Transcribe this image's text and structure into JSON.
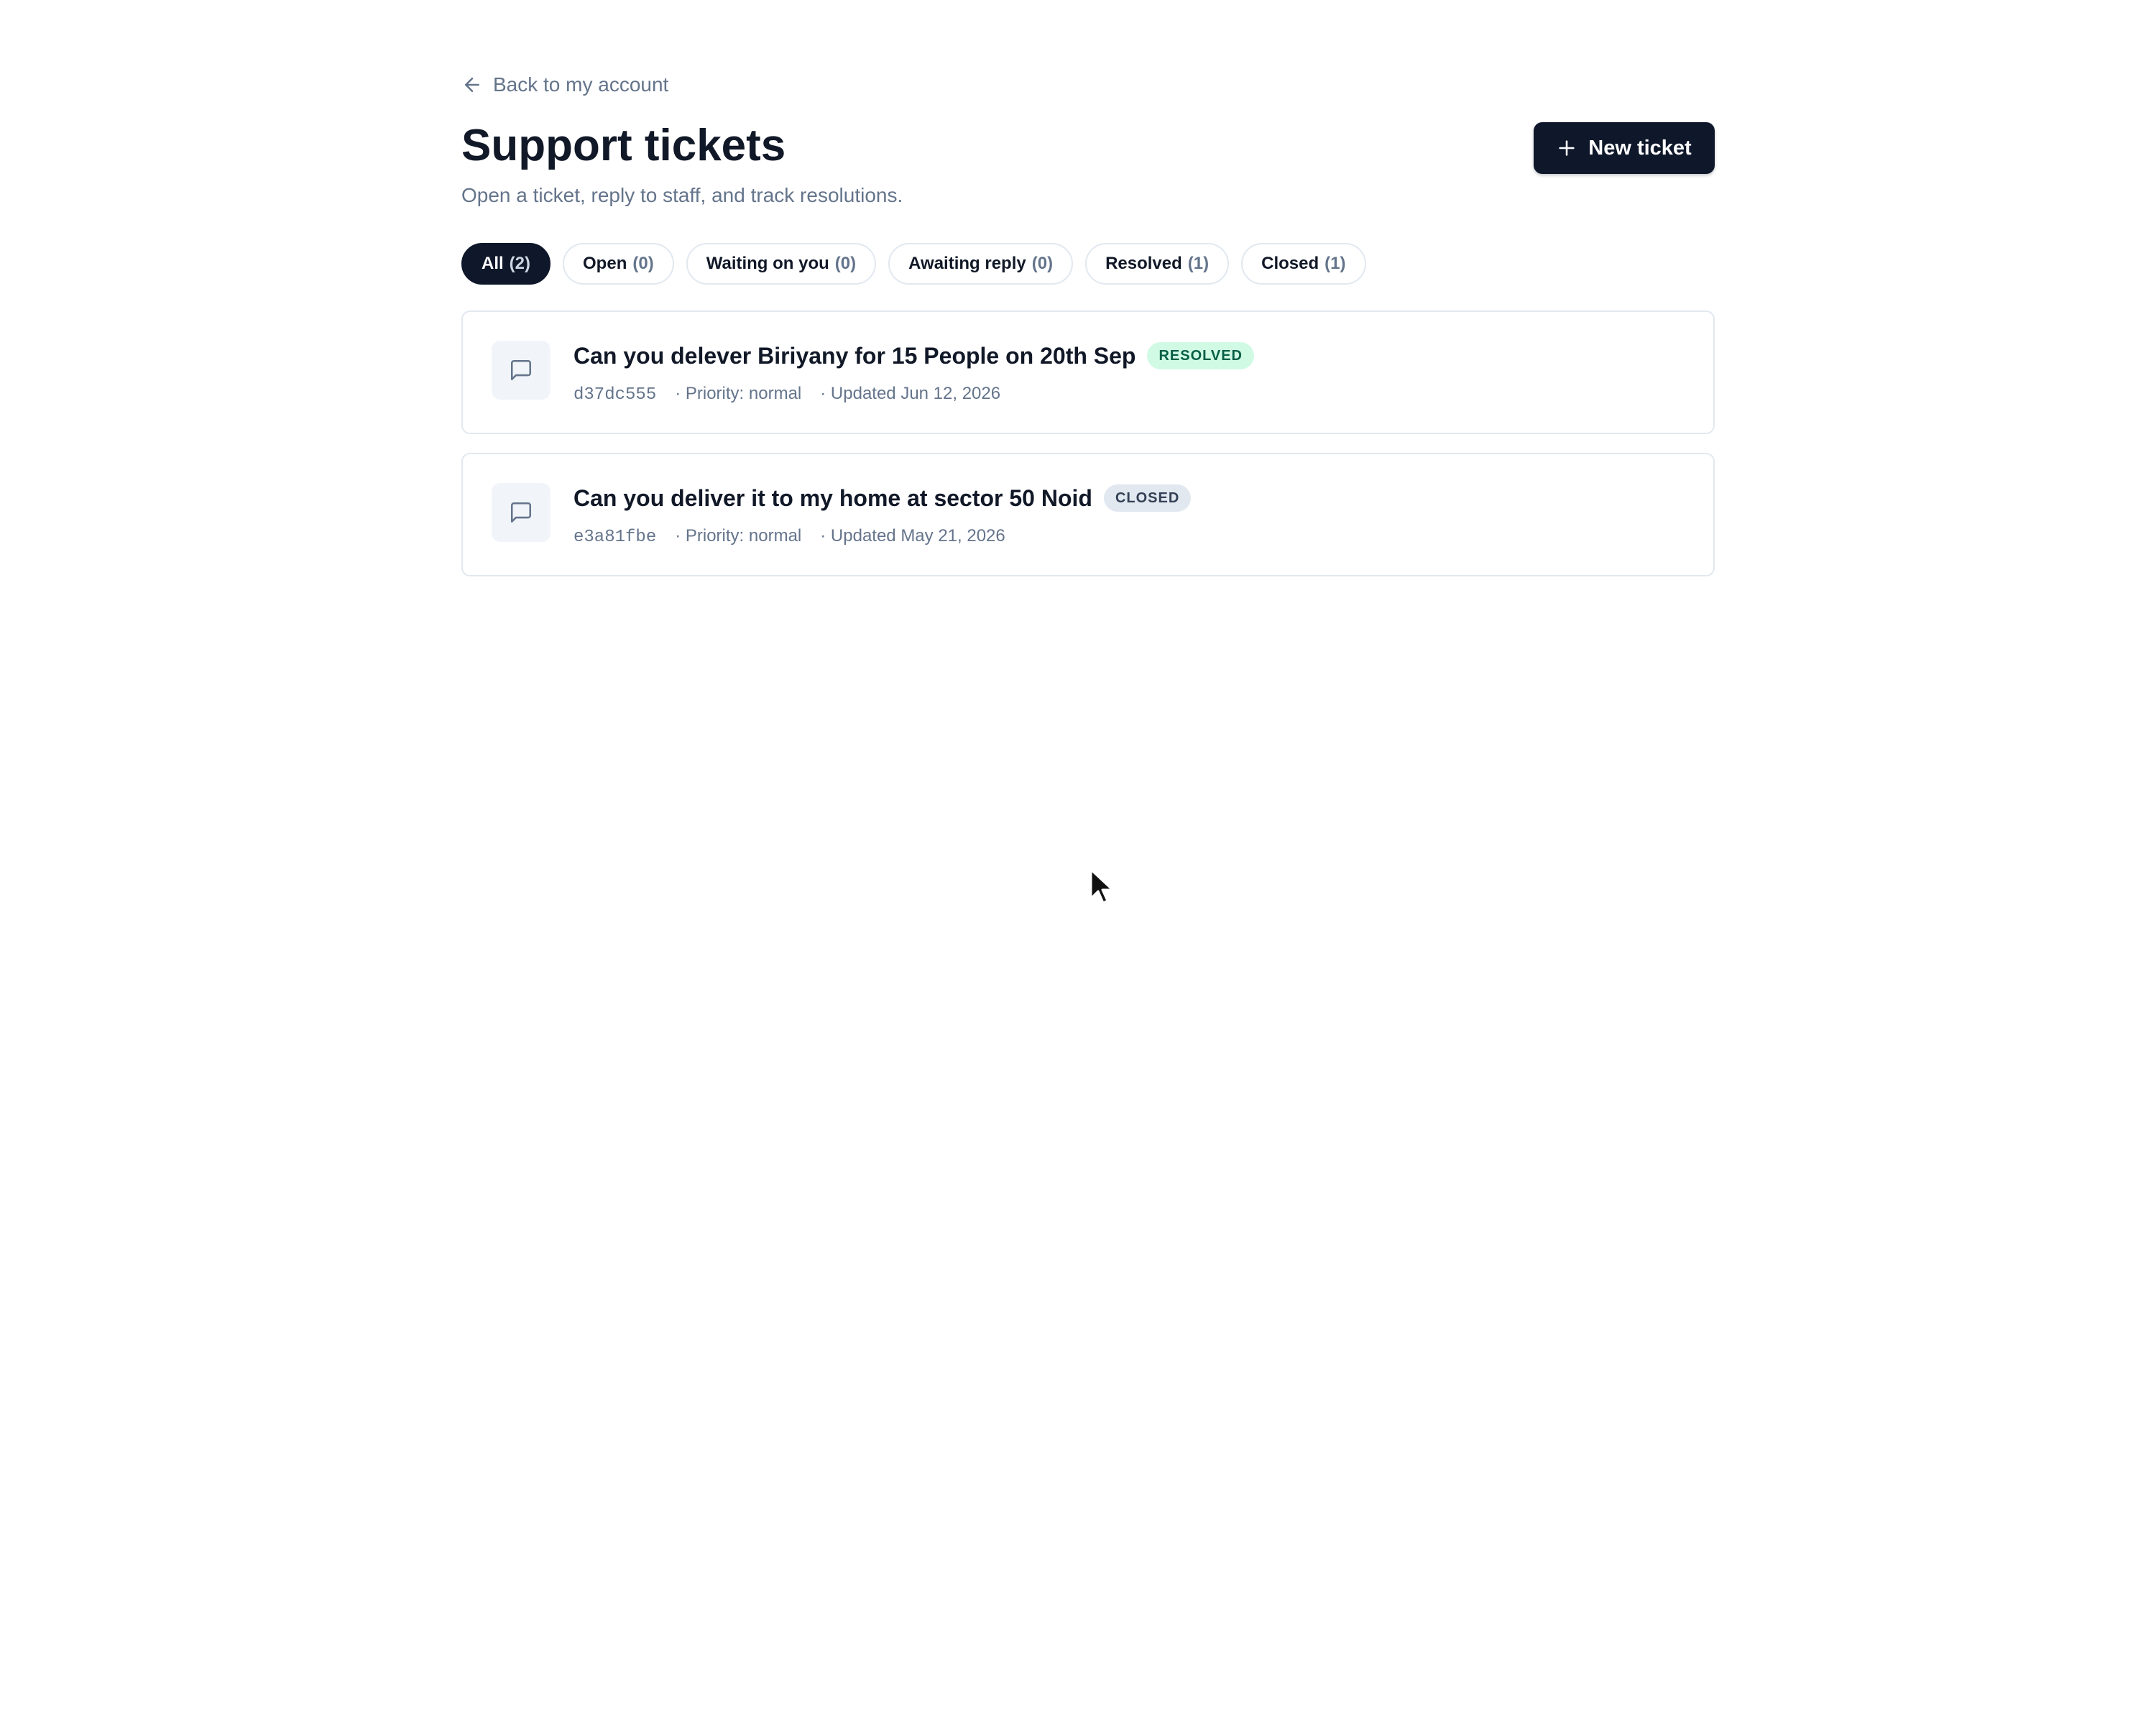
{
  "nav": {
    "back_label": "Back to my account"
  },
  "header": {
    "title": "Support tickets",
    "subtitle": "Open a ticket, reply to staff, and track resolutions.",
    "new_ticket_label": "New ticket"
  },
  "filters": [
    {
      "label": "All",
      "count": "(2)",
      "active": true
    },
    {
      "label": "Open",
      "count": "(0)",
      "active": false
    },
    {
      "label": "Waiting on you",
      "count": "(0)",
      "active": false
    },
    {
      "label": "Awaiting reply",
      "count": "(0)",
      "active": false
    },
    {
      "label": "Resolved",
      "count": "(1)",
      "active": false
    },
    {
      "label": "Closed",
      "count": "(1)",
      "active": false
    }
  ],
  "tickets": [
    {
      "title": "Can you delever Biriyany for 15 People on 20th Sep",
      "status": "RESOLVED",
      "id": "d37dc555",
      "priority": "· Priority: normal",
      "updated": "· Updated Jun 12, 2026"
    },
    {
      "title": "Can you deliver it to my home at sector 50 Noid",
      "status": "CLOSED",
      "id": "e3a81fbe",
      "priority": "· Priority: normal",
      "updated": "· Updated May 21, 2026"
    }
  ],
  "icons": {
    "back": "arrow-left-icon",
    "new": "plus-icon",
    "ticket": "message-square-icon",
    "cursor": "mouse-pointer-icon"
  },
  "colors": {
    "primary": "#0f172a",
    "muted_text": "#64748b",
    "border": "#e2e8f0",
    "resolved_bg": "#d1fae5",
    "resolved_text": "#065f46",
    "closed_bg": "#e2e8f0",
    "closed_text": "#334155"
  }
}
